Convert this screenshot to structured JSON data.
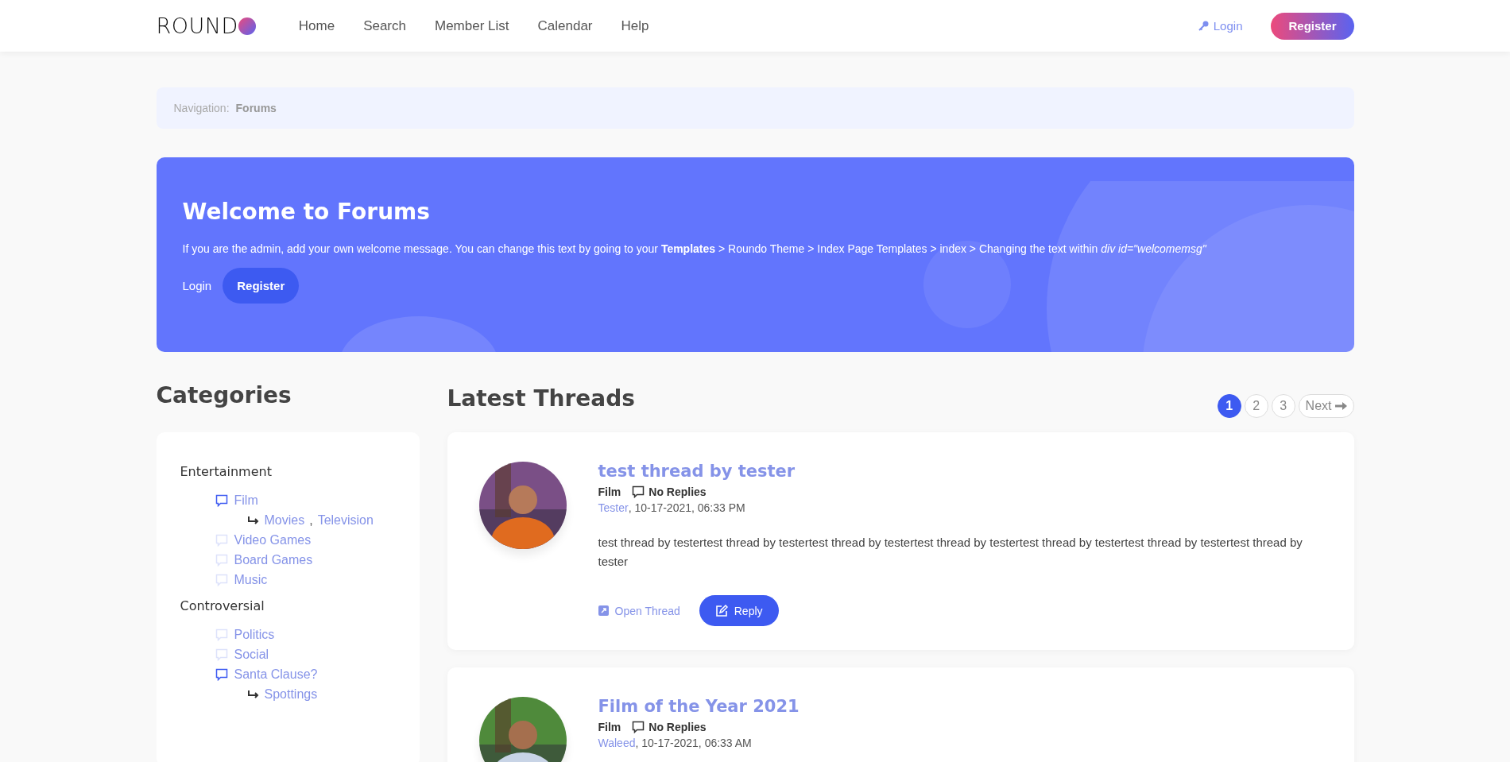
{
  "header": {
    "logo": "ROUND",
    "nav": [
      {
        "label": "Home"
      },
      {
        "label": "Search"
      },
      {
        "label": "Member List"
      },
      {
        "label": "Calendar"
      },
      {
        "label": "Help"
      }
    ],
    "login": "Login",
    "register": "Register"
  },
  "breadcrumb": {
    "label": "Navigation:",
    "current": "Forums"
  },
  "welcome": {
    "title": "Welcome to Forums",
    "message": "If you are the admin, add your own welcome message. You can change this text by going to your **Templates** > Roundo Theme > Index Page Templates > index > Changing the text within *div id=\"welcomemsg\"*",
    "login": "Login",
    "register": "Register"
  },
  "categories": {
    "title": "Categories",
    "groups": [
      {
        "name": "Entertainment",
        "forums": [
          {
            "name": "Film",
            "unread": true,
            "separator": ",",
            "subforums": [
              "Movies",
              "Television"
            ]
          },
          {
            "name": "Video Games",
            "unread": false
          },
          {
            "name": "Board Games",
            "unread": false
          },
          {
            "name": "Music",
            "unread": false
          }
        ]
      },
      {
        "name": "Controversial",
        "forums": [
          {
            "name": "Politics",
            "unread": false
          },
          {
            "name": "Social",
            "unread": false
          },
          {
            "name": "Santa Clause?",
            "unread": true,
            "subforums": [
              "Spottings"
            ]
          }
        ]
      }
    ]
  },
  "threads": {
    "title": "Latest Threads",
    "pages": [
      {
        "label": "1",
        "selected": true
      },
      {
        "label": "2",
        "selected": false
      },
      {
        "label": "3",
        "selected": false
      }
    ],
    "next": "Next",
    "items": [
      {
        "title": "test thread by tester",
        "forum": "Film",
        "replies": "No Replies",
        "author": "Tester",
        "date": ", 10-17-2021, 06:33 PM",
        "body": "test thread by testertest thread by testertest thread by testertest thread by testertest thread by testertest thread by testertest thread by tester",
        "open": "Open Thread",
        "reply": "Reply"
      },
      {
        "title": "Film of the Year 2021",
        "forum": "Film",
        "replies": "No Replies",
        "author": "Waleed",
        "date": ", 10-17-2021, 06:33 AM"
      }
    ]
  }
}
